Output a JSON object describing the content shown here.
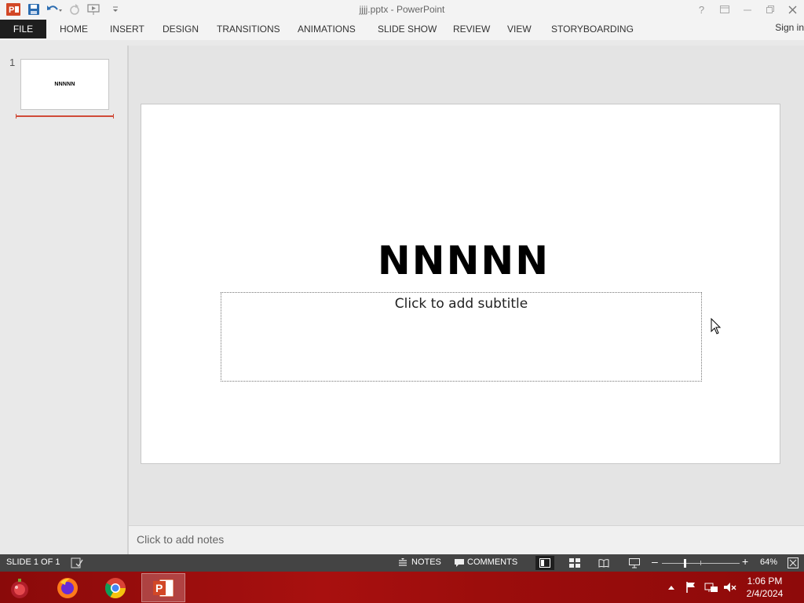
{
  "window": {
    "title": "jjjj.pptx - PowerPoint"
  },
  "ribbon": {
    "file": "FILE",
    "tabs": [
      "HOME",
      "INSERT",
      "DESIGN",
      "TRANSITIONS",
      "ANIMATIONS",
      "SLIDE SHOW",
      "REVIEW",
      "VIEW",
      "STORYBOARDING"
    ],
    "sign_in": "Sign in"
  },
  "thumbnails": [
    {
      "number": "1",
      "title": "NNNNN"
    }
  ],
  "slide": {
    "title": "NNNNN",
    "subtitle_placeholder": "Click to add subtitle"
  },
  "notes": {
    "placeholder": "Click to add notes"
  },
  "status": {
    "slide_info": "SLIDE 1 OF 1",
    "notes": "NOTES",
    "comments": "COMMENTS",
    "zoom": "64%"
  },
  "taskbar": {
    "apps": [
      "firefox",
      "chrome",
      "powerpoint"
    ],
    "time": "1:06 PM",
    "date": "2/4/2024"
  },
  "colors": {
    "accent": "#d04b38",
    "file_tab": "#1e1e1e",
    "status_bar": "#444444",
    "taskbar": "#9c0d0c"
  }
}
